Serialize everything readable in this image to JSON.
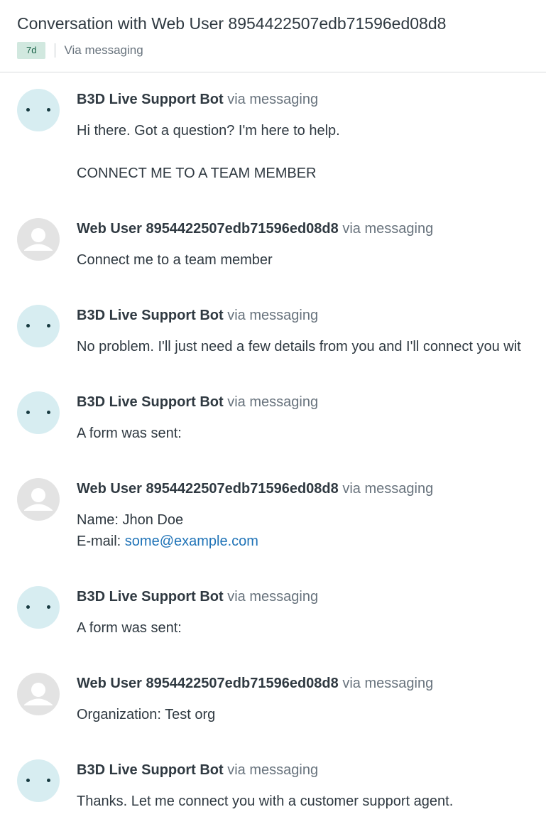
{
  "header": {
    "title": "Conversation with Web User 8954422507edb71596ed08d8",
    "age_badge": "7d",
    "channel": "Via messaging"
  },
  "colors": {
    "bot_avatar_bg": "#d7edf1",
    "user_avatar_bg": "#e3e3e3",
    "badge_bg": "#d1e8df",
    "link": "#1f73b7"
  },
  "messages": [
    {
      "author": "B3D Live Support Bot",
      "via": "via messaging",
      "avatar": "bot-icon",
      "lines": [
        "Hi there. Got a question? I'm here to help.",
        "CONNECT ME TO A TEAM MEMBER"
      ]
    },
    {
      "author": "Web User 8954422507edb71596ed08d8",
      "via": "via messaging",
      "avatar": "user-silhouette-icon",
      "lines": [
        "Connect me to a team member"
      ]
    },
    {
      "author": "B3D Live Support Bot",
      "via": "via messaging",
      "avatar": "bot-icon",
      "lines": [
        "No problem. I'll just need a few details from you and I'll connect you wit"
      ]
    },
    {
      "author": "B3D Live Support Bot",
      "via": "via messaging",
      "avatar": "bot-icon",
      "lines": [
        "A form was sent:"
      ]
    },
    {
      "author": "Web User 8954422507edb71596ed08d8",
      "via": "via messaging",
      "avatar": "user-silhouette-icon",
      "lines": [
        "Name: Jhon Doe"
      ],
      "email_label": "E-mail:",
      "email_value": "some@example.com"
    },
    {
      "author": "B3D Live Support Bot",
      "via": "via messaging",
      "avatar": "bot-icon",
      "lines": [
        "A form was sent:"
      ]
    },
    {
      "author": "Web User 8954422507edb71596ed08d8",
      "via": "via messaging",
      "avatar": "user-silhouette-icon",
      "lines": [
        "Organization: Test org"
      ]
    },
    {
      "author": "B3D Live Support Bot",
      "via": "via messaging",
      "avatar": "bot-icon",
      "lines": [
        "Thanks. Let me connect you with a customer support agent."
      ]
    }
  ]
}
